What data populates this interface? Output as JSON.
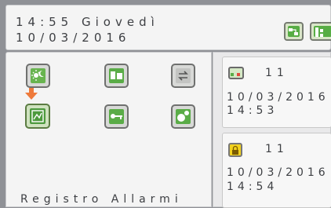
{
  "header": {
    "time_day": "14:55 Giovedì",
    "date": "10/03/2016"
  },
  "menu": {
    "section_title": "Registro Allarmi",
    "items": [
      {
        "name": "climate-icon"
      },
      {
        "name": "screen-icon"
      },
      {
        "name": "sync-icon"
      },
      {
        "name": "alarm-log-icon",
        "selected": true
      },
      {
        "name": "key-icon"
      },
      {
        "name": "device-icon"
      }
    ]
  },
  "alarms": [
    {
      "icon": "alarm-network-icon",
      "count": "11",
      "date": "10/03/2016",
      "time": "14:53"
    },
    {
      "icon": "alarm-lock-icon",
      "count": "11",
      "date": "10/03/2016",
      "time": "14:54"
    }
  ],
  "colors": {
    "selected_accent": "#5b7c42",
    "arrow": "#ee7a3b",
    "icon_green": "#57ad44",
    "alarm_yellow": "#f2d21e"
  }
}
